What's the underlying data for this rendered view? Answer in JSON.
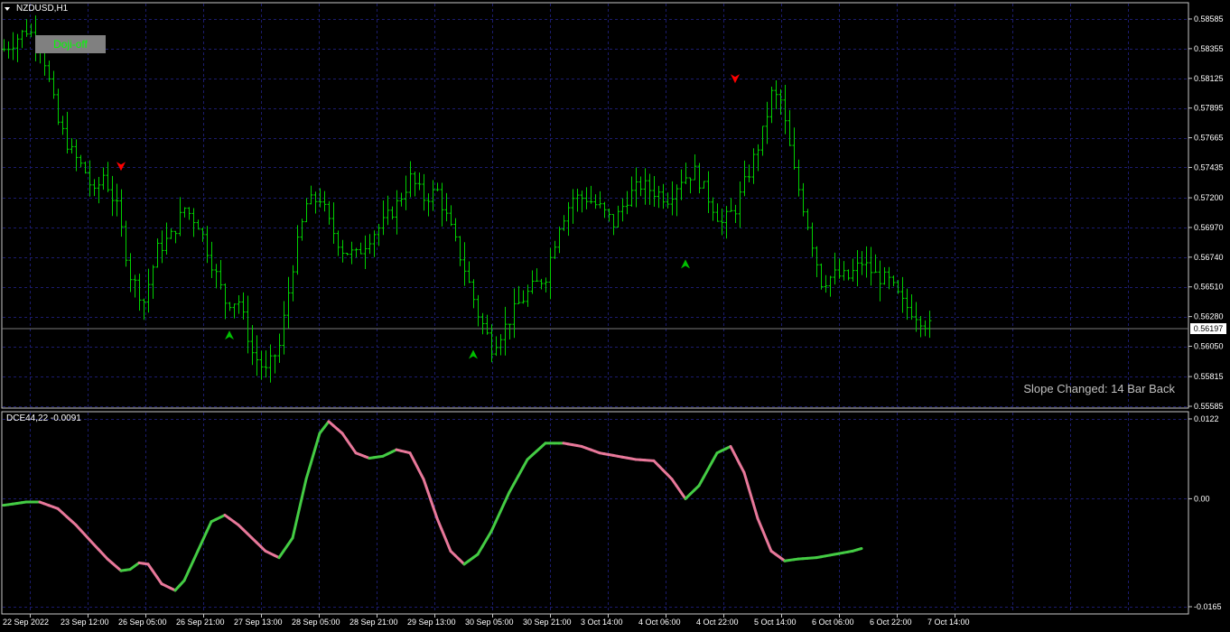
{
  "main_pane": {
    "title": "NZDUSD,H1",
    "doji_button": "Doji-off",
    "slope_text": "Slope Changed: 14 Bar Back",
    "current_price": "0.56197"
  },
  "indicator_pane": {
    "title": "DCE44,22 -0.0091"
  },
  "colors": {
    "background": "#000000",
    "grid": "#1c1c6e",
    "bars": "#00d000",
    "up_arrow": "#00c000",
    "down_arrow": "#ff0000",
    "rising": "#44cc44",
    "falling": "#e8789a"
  },
  "chart_data": [
    {
      "type": "ohlc",
      "symbol": "NZDUSD",
      "timeframe": "H1",
      "y_ticks": [
        "0.58585",
        "0.58355",
        "0.58125",
        "0.57895",
        "0.57665",
        "0.57435",
        "0.57200",
        "0.56970",
        "0.56740",
        "0.56510",
        "0.56280",
        "0.56050",
        "0.55815",
        "0.55585"
      ],
      "ylim": [
        0.55585,
        0.58585
      ],
      "x_ticks": [
        "22 Sep 2022",
        "23 Sep 12:00",
        "26 Sep 05:00",
        "26 Sep 21:00",
        "27 Sep 13:00",
        "28 Sep 05:00",
        "28 Sep 21:00",
        "29 Sep 13:00",
        "30 Sep 05:00",
        "30 Sep 21:00",
        "3 Oct 14:00",
        "4 Oct 06:00",
        "4 Oct 22:00",
        "5 Oct 14:00",
        "6 Oct 06:00",
        "6 Oct 22:00",
        "7 Oct 14:00"
      ],
      "price_path": [
        [
          0,
          0.5835
        ],
        [
          5,
          0.585
        ],
        [
          8,
          0.5842
        ],
        [
          12,
          0.5778
        ],
        [
          15,
          0.5755
        ],
        [
          18,
          0.574
        ],
        [
          20,
          0.5722
        ],
        [
          22,
          0.5738
        ],
        [
          25,
          0.5712
        ],
        [
          28,
          0.566
        ],
        [
          31,
          0.564
        ],
        [
          34,
          0.568
        ],
        [
          37,
          0.569
        ],
        [
          40,
          0.5712
        ],
        [
          43,
          0.57
        ],
        [
          46,
          0.567
        ],
        [
          49,
          0.564
        ],
        [
          52,
          0.564
        ],
        [
          55,
          0.56
        ],
        [
          58,
          0.5585
        ],
        [
          61,
          0.5605
        ],
        [
          64,
          0.5668
        ],
        [
          67,
          0.5715
        ],
        [
          70,
          0.572
        ],
        [
          72,
          0.57
        ],
        [
          75,
          0.568
        ],
        [
          78,
          0.5675
        ],
        [
          81,
          0.569
        ],
        [
          84,
          0.57
        ],
        [
          87,
          0.5715
        ],
        [
          90,
          0.5735
        ],
        [
          93,
          0.572
        ],
        [
          96,
          0.5725
        ],
        [
          99,
          0.5695
        ],
        [
          102,
          0.5665
        ],
        [
          105,
          0.563
        ],
        [
          108,
          0.5605
        ],
        [
          111,
          0.562
        ],
        [
          114,
          0.5638
        ],
        [
          117,
          0.565
        ],
        [
          120,
          0.566
        ],
        [
          123,
          0.57
        ],
        [
          126,
          0.572
        ],
        [
          129,
          0.572
        ],
        [
          132,
          0.5712
        ],
        [
          135,
          0.57
        ],
        [
          138,
          0.572
        ],
        [
          141,
          0.573
        ],
        [
          144,
          0.5725
        ],
        [
          147,
          0.572
        ],
        [
          150,
          0.5735
        ],
        [
          153,
          0.574
        ],
        [
          156,
          0.572
        ],
        [
          159,
          0.57
        ],
        [
          162,
          0.5712
        ],
        [
          165,
          0.574
        ],
        [
          168,
          0.577
        ],
        [
          170,
          0.58
        ],
        [
          172,
          0.5795
        ],
        [
          175,
          0.574
        ],
        [
          178,
          0.57
        ],
        [
          181,
          0.5655
        ],
        [
          184,
          0.566
        ],
        [
          187,
          0.5658
        ],
        [
          190,
          0.567
        ],
        [
          193,
          0.566
        ],
        [
          196,
          0.5655
        ],
        [
          199,
          0.5638
        ],
        [
          202,
          0.563
        ],
        [
          205,
          0.562
        ]
      ],
      "buy_signals": [
        {
          "bar": 50,
          "price": 0.5613
        },
        {
          "bar": 104,
          "price": 0.5598
        },
        {
          "bar": 151,
          "price": 0.5668
        }
      ],
      "sell_signals": [
        {
          "bar": 26,
          "price": 0.5745
        },
        {
          "bar": 162,
          "price": 0.5813
        }
      ]
    },
    {
      "type": "line",
      "name": "DCE44,22",
      "last_value": -0.0091,
      "y_ticks": [
        "0.0122",
        "0.00",
        "-0.0165"
      ],
      "ylim": [
        -0.0165,
        0.0122
      ],
      "points": [
        [
          0,
          -0.001
        ],
        [
          5,
          -0.0005
        ],
        [
          8,
          -0.0005
        ],
        [
          12,
          -0.0015
        ],
        [
          16,
          -0.004
        ],
        [
          20,
          -0.007
        ],
        [
          23,
          -0.0092
        ],
        [
          26,
          -0.011
        ],
        [
          28,
          -0.0108
        ],
        [
          30,
          -0.0098
        ],
        [
          32,
          -0.01
        ],
        [
          35,
          -0.013
        ],
        [
          38,
          -0.014
        ],
        [
          40,
          -0.0125
        ],
        [
          43,
          -0.008
        ],
        [
          46,
          -0.0035
        ],
        [
          49,
          -0.0025
        ],
        [
          52,
          -0.004
        ],
        [
          55,
          -0.006
        ],
        [
          58,
          -0.008
        ],
        [
          61,
          -0.009
        ],
        [
          64,
          -0.006
        ],
        [
          67,
          0.003
        ],
        [
          70,
          0.01
        ],
        [
          72,
          0.0118
        ],
        [
          75,
          0.01
        ],
        [
          78,
          0.007
        ],
        [
          81,
          0.0062
        ],
        [
          84,
          0.0065
        ],
        [
          87,
          0.0075
        ],
        [
          90,
          0.007
        ],
        [
          93,
          0.003
        ],
        [
          96,
          -0.003
        ],
        [
          99,
          -0.008
        ],
        [
          102,
          -0.01
        ],
        [
          105,
          -0.0085
        ],
        [
          108,
          -0.005
        ],
        [
          112,
          0.001
        ],
        [
          116,
          0.006
        ],
        [
          120,
          0.0085
        ],
        [
          124,
          0.0085
        ],
        [
          128,
          0.008
        ],
        [
          132,
          0.007
        ],
        [
          136,
          0.0065
        ],
        [
          140,
          0.006
        ],
        [
          144,
          0.0058
        ],
        [
          148,
          0.003
        ],
        [
          151,
          0.0
        ],
        [
          154,
          0.002
        ],
        [
          158,
          0.007
        ],
        [
          161,
          0.008
        ],
        [
          164,
          0.004
        ],
        [
          167,
          -0.003
        ],
        [
          170,
          -0.008
        ],
        [
          173,
          -0.0095
        ],
        [
          176,
          -0.0092
        ],
        [
          180,
          -0.009
        ],
        [
          184,
          -0.0085
        ],
        [
          188,
          -0.008
        ],
        [
          190,
          -0.0076
        ]
      ]
    }
  ]
}
